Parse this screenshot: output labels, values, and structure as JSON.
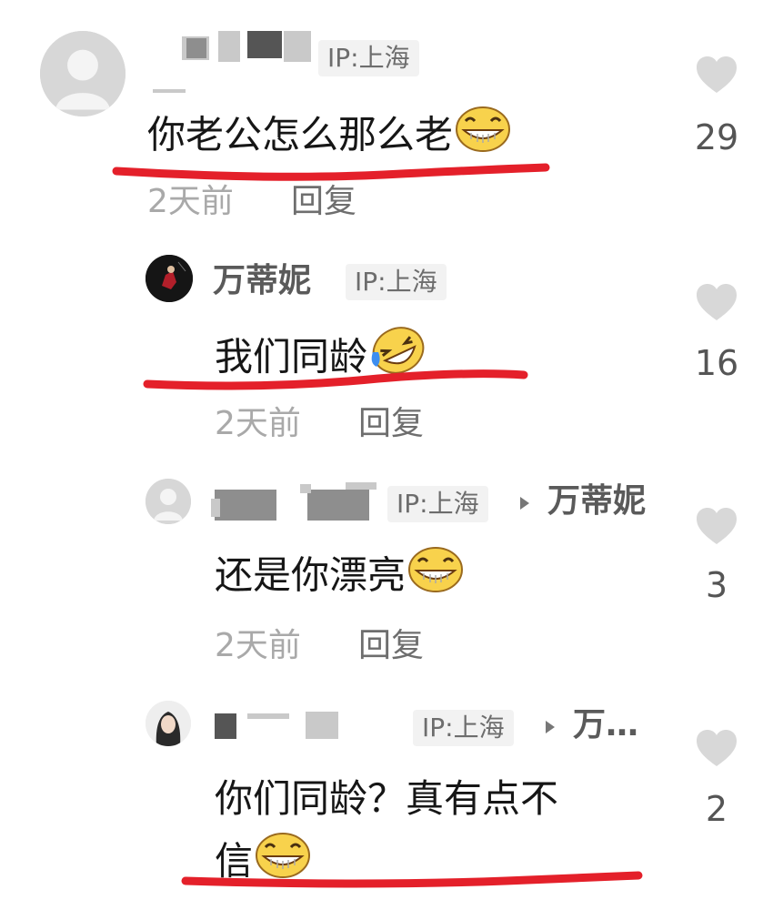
{
  "comments": [
    {
      "ip": "IP:上海",
      "text": "你老公怎么那么老",
      "time": "2天前",
      "reply_label": "回复",
      "likes": "29",
      "emoji": "grinning-face"
    },
    {
      "username": "万蒂妮",
      "ip": "IP:上海",
      "text": "我们同龄",
      "time": "2天前",
      "reply_label": "回复",
      "likes": "16",
      "emoji": "rolling-on-floor-laughing"
    },
    {
      "ip": "IP:上海",
      "reply_to": "万蒂妮",
      "text": "还是你漂亮",
      "time": "2天前",
      "reply_label": "回复",
      "likes": "3",
      "emoji": "grinning-face"
    },
    {
      "ip": "IP:上海",
      "reply_to": "万…",
      "text_line1": "你们同龄？真有点不",
      "text_line2": "信",
      "likes": "2",
      "emoji": "grinning-face"
    }
  ],
  "colors": {
    "highlight_underline": "#e4202a",
    "like_icon": "#d8d8d8",
    "ip_tag_bg": "#f2f2f2"
  },
  "icons": {
    "like": "heart-icon",
    "reply_arrow": "triangle-right-icon",
    "default_avatar": "person-silhouette-icon"
  }
}
